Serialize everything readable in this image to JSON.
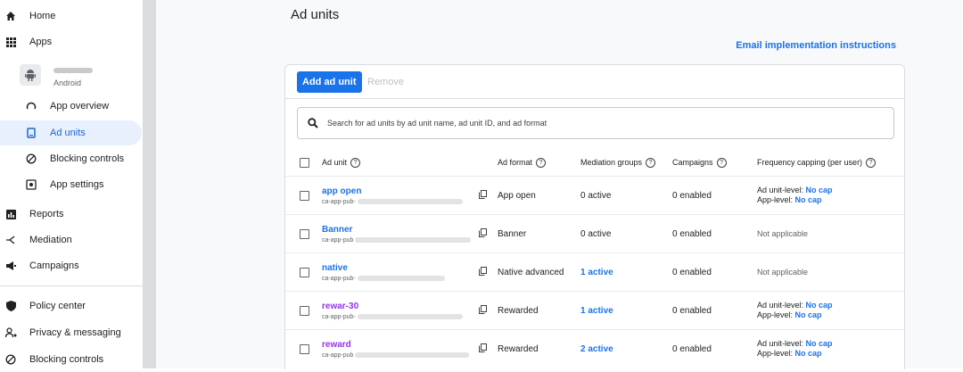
{
  "sidebar": {
    "home": "Home",
    "apps": "Apps",
    "app_platform": "Android",
    "app_overview": "App overview",
    "ad_units": "Ad units",
    "blocking_controls_sub": "Blocking controls",
    "app_settings": "App settings",
    "reports": "Reports",
    "mediation": "Mediation",
    "campaigns": "Campaigns",
    "policy_center": "Policy center",
    "privacy_messaging": "Privacy & messaging",
    "blocking_controls": "Blocking controls"
  },
  "page": {
    "title": "Ad units",
    "email_link": "Email implementation instructions"
  },
  "toolbar": {
    "add_label": "Add ad unit",
    "remove_label": "Remove"
  },
  "search": {
    "placeholder": "Search for ad units by ad unit name, ad unit ID, and ad format"
  },
  "table": {
    "headers": {
      "ad_unit": "Ad unit",
      "ad_format": "Ad format",
      "mediation_groups": "Mediation groups",
      "campaigns": "Campaigns",
      "frequency_capping": "Frequency capping (per user)"
    },
    "rows": [
      {
        "name": "app open",
        "id_prefix": "ca-app-pub-",
        "format": "App open",
        "mediation": "0 active",
        "campaigns": "0 enabled",
        "freq_line1_label": "Ad unit-level: ",
        "freq_line1_value": "No cap",
        "freq_line2_label": "App-level: ",
        "freq_line2_value": "No cap"
      },
      {
        "name": "Banner",
        "id_prefix": "ca-app-pub",
        "format": "Banner",
        "mediation": "0 active",
        "campaigns": "0 enabled",
        "freq_na": "Not applicable"
      },
      {
        "name": "native",
        "id_prefix": "ca-app-pub-",
        "format": "Native advanced",
        "mediation": "1 active",
        "campaigns": "0 enabled",
        "freq_na": "Not applicable"
      },
      {
        "name": "rewar-30",
        "id_prefix": "ca-app-pub-",
        "format": "Rewarded",
        "mediation": "1 active",
        "campaigns": "0 enabled",
        "freq_line1_label": "Ad unit-level: ",
        "freq_line1_value": "No cap",
        "freq_line2_label": "App-level: ",
        "freq_line2_value": "No cap"
      },
      {
        "name": "reward",
        "id_prefix": "ca-app-pub",
        "format": "Rewarded",
        "mediation": "2 active",
        "campaigns": "0 enabled",
        "freq_line1_label": "Ad unit-level: ",
        "freq_line1_value": "No cap",
        "freq_line2_label": "App-level: ",
        "freq_line2_value": "No cap"
      }
    ]
  },
  "colors": {
    "accent": "#1a73e8",
    "visited": "#9334e6",
    "active_nav_bg": "#e8f0fe"
  }
}
